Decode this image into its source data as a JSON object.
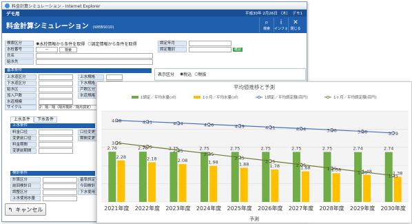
{
  "window": {
    "title": "料金計算シミュレーション - Internet Explorer"
  },
  "app": {
    "brand": "デモ用",
    "date": "平成30年 2月26日 （木）",
    "user": "デモ1"
  },
  "header": {
    "title": "料金計算シミュレーション",
    "code": "(WEBS010)",
    "buttons": [
      {
        "icon": "magnifier",
        "label": "検索"
      },
      {
        "icon": "info",
        "label": "インフォ"
      },
      {
        "icon": "close",
        "label": "閉じる"
      }
    ]
  },
  "form": {
    "search_label": "検索区分",
    "radio1": "水栓情報から条件を取得",
    "radio2": "調定情報から条件を取得",
    "meter_label": "水栓番号",
    "meter_value": "—",
    "meter_btn": "検索",
    "addr_label": "氏名",
    "place_label": "給水先",
    "year_label": "調定年月",
    "cycle_label": "調定種別",
    "cycle_btn": "確認"
  },
  "basic": {
    "section": "基本条件",
    "fields": [
      "上水道区分",
      "下水道区分",
      "給水区",
      "加入戸数",
      "水道規模",
      "サイクル"
    ],
    "fields_right": [
      "上水規格",
      "下水規格",
      "戸数区分",
      "水道規格"
    ],
    "cycle_value": "2：隔／隔（隔月検針／隔月調定）"
  },
  "tabs": [
    "上水条件",
    "下水条件"
  ],
  "water": {
    "section": "上水条件",
    "fields": [
      "料金口径",
      "変更前口径",
      "料金期間",
      "変更前期間"
    ],
    "fields_right": [
      "口径変更",
      "期間変更"
    ]
  },
  "detail": {
    "section": "検針条件",
    "fields": [
      "計算区分",
      "前回検針日",
      "調整区分",
      "上水使用水量"
    ],
    "fields_right": [
      "基準調定",
      "今回検針",
      "下水使用"
    ]
  },
  "mini": {
    "label": "表示区分",
    "opt1": "税込",
    "opt2": "税抜"
  },
  "cancel": {
    "icon": "back-arrow",
    "label": "キャンセル"
  },
  "colors": {
    "green": "#70ad47",
    "yellow": "#ffc000",
    "blue": "#4472c4",
    "olive": "#6b7d33"
  },
  "chart_data": {
    "type": "bar",
    "title": "平均値推移と予測",
    "xlabel": "予測",
    "categories": [
      "2021年度",
      "2022年度",
      "2023年度",
      "2024年度",
      "2025年度",
      "2026年度",
      "2027年度",
      "2028年度",
      "2029年度",
      "2030年度"
    ],
    "legend": [
      "1調定／平均水量(㎥)",
      "1ヶ月／平均水量(㎥)",
      "1調定／平均調定額(百円)",
      "1ヶ月／平均調定額(百円)"
    ],
    "legend_position": "top",
    "series": [
      {
        "name": "1調定／平均水量(㎥)",
        "type": "bar",
        "values": [
          2.76,
          2.76,
          2.75,
          2.75,
          2.75,
          2.75,
          2.75,
          2.75,
          2.74,
          2.74
        ],
        "color": "#70ad47"
      },
      {
        "name": "1ヶ月／平均水量(㎥)",
        "type": "bar",
        "values": [
          2.28,
          2.18,
          2.08,
          1.98,
          1.88,
          1.78,
          1.68,
          1.58,
          1.48,
          1.38
        ],
        "color": "#ffc000"
      },
      {
        "name": "1調定／平均調定額(百円)",
        "type": "line",
        "values": [
          4.48,
          4.41,
          4.34,
          4.26,
          4.19,
          4.11,
          4.04,
          3.96,
          3.88,
          3.79
        ],
        "color": "#4472c4"
      },
      {
        "name": "1ヶ月／平均調定額(百円)",
        "type": "line",
        "values": [
          3.25,
          3.05,
          2.85,
          2.65,
          2.45,
          2.25,
          2.05,
          1.85,
          1.65,
          1.45
        ],
        "color": "#6b7d33"
      }
    ],
    "ylim": [
      0,
      5
    ],
    "grid": true
  }
}
